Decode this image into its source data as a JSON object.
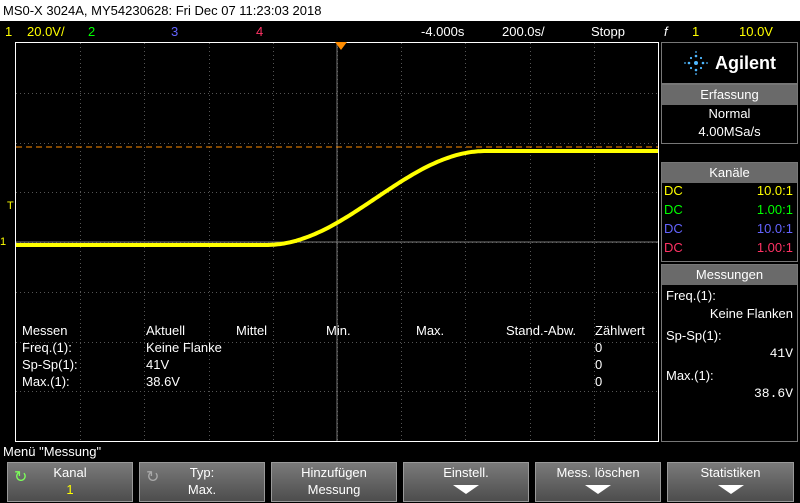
{
  "title": "MS0-X 3024A, MY54230628: Fri Dec 07 11:23:03 2018",
  "channels_bar": {
    "ch1_num": "1",
    "ch1_scale": "20.0V/",
    "ch2_num": "2",
    "ch3_num": "3",
    "ch4_num": "4",
    "time_offset": "-4.000s",
    "time_scale": "200.0s/",
    "run_state": "Stopp",
    "trigger_icon": "f",
    "trig_ch": "1",
    "trig_level": "10.0V"
  },
  "colors": {
    "ch1": "#ffff00",
    "ch2": "#00ff00",
    "ch3": "#6464ff",
    "ch4": "#ff3264",
    "trigger_marker": "#ff8c00",
    "grid": "#555555"
  },
  "measurement_table": {
    "headers": [
      "Messen",
      "Aktuell",
      "Mittel",
      "Min.",
      "Max.",
      "Stand.-Abw.",
      "Zählwert"
    ],
    "rows": [
      [
        "Freq.(1):",
        "Keine Flanke",
        "",
        "",
        "",
        "",
        "0"
      ],
      [
        "Sp-Sp(1):",
        "41V",
        "",
        "",
        "",
        "",
        "0"
      ],
      [
        "Max.(1):",
        "38.6V",
        "",
        "",
        "",
        "",
        "0"
      ]
    ]
  },
  "side": {
    "brand": "Agilent",
    "erfassung": {
      "head": "Erfassung",
      "mode": "Normal",
      "rate": "4.00MSa/s"
    },
    "kanaele": {
      "head": "Kanäle",
      "rows": [
        {
          "coupling": "DC",
          "probe": "10.0:1"
        },
        {
          "coupling": "DC",
          "probe": "1.00:1"
        },
        {
          "coupling": "DC",
          "probe": "10.0:1"
        },
        {
          "coupling": "DC",
          "probe": "1.00:1"
        }
      ]
    },
    "messungen": {
      "head": "Messungen",
      "items": [
        {
          "label": "Freq.(1):",
          "value": "Keine Flanken"
        },
        {
          "label": "Sp-Sp(1):",
          "value": "41V"
        },
        {
          "label": "Max.(1):",
          "value": "38.6V"
        }
      ]
    }
  },
  "menu_label": "Menü \"Messung\"",
  "softkeys": [
    {
      "line1": "Kanal",
      "line2": "1"
    },
    {
      "line1": "Typ:",
      "line2": "Max."
    },
    {
      "line1": "Hinzufügen",
      "line2": "Messung"
    },
    {
      "line1": "Einstell.",
      "line2": ""
    },
    {
      "line1": "Mess. löschen",
      "line2": ""
    },
    {
      "line1": "Statistiken",
      "line2": ""
    }
  ],
  "markers": {
    "trigger_label": "T",
    "ground_label": "1"
  }
}
